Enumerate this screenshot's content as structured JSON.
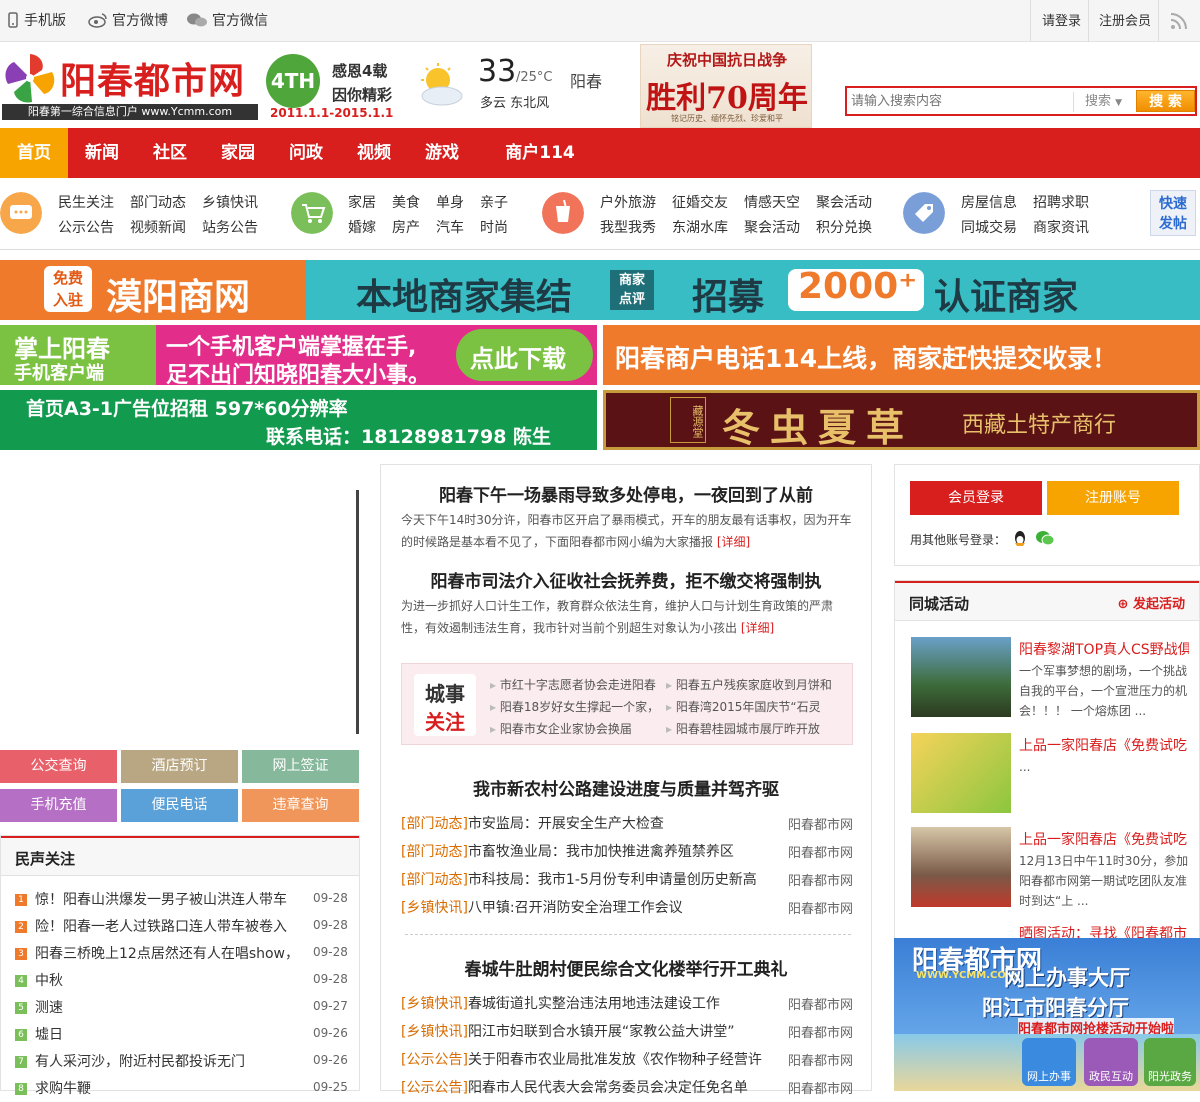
{
  "topbar": {
    "mobile": "手机版",
    "weibo": "官方微博",
    "wechat": "官方微信",
    "login": "请登录",
    "register": "注册会员"
  },
  "logo": {
    "title": "阳春都市网",
    "subtitle": "阳春第一综合信息门户 www.Ycmm.com"
  },
  "anniversary": {
    "badge": "4TH",
    "line1": "感恩4载",
    "line2": "因你精彩",
    "dates": "2011.1.1-2015.1.1"
  },
  "weather": {
    "temp": "33",
    "range": "/25°C",
    "city": "阳春",
    "condition": "多云  东北风"
  },
  "victory_banner": {
    "line1": "庆祝中国抗日战争",
    "line2": "胜利70周年",
    "line3": "铭记历史、缅怀先烈、珍爱和平"
  },
  "search": {
    "placeholder": "请输入搜索内容",
    "dropdown": "搜索",
    "button": "搜 索"
  },
  "nav": [
    "首页",
    "新闻",
    "社区",
    "家园",
    "问政",
    "视频",
    "游戏",
    "商户114"
  ],
  "subnav": {
    "group1": [
      "民生关注",
      "部门动态",
      "乡镇快讯",
      "公示公告",
      "视频新闻",
      "站务公告"
    ],
    "group2": [
      "家居",
      "美食",
      "单身",
      "亲子",
      "婚嫁",
      "房产",
      "汽车",
      "时尚"
    ],
    "group3": [
      "户外旅游",
      "征婚交友",
      "情感天空",
      "聚会活动",
      "我型我秀",
      "东湖水库",
      "聚会活动",
      "积分兑换"
    ],
    "group4": [
      "房屋信息",
      "招聘求职",
      "同城交易",
      "商家资讯"
    ],
    "quickpost": [
      "快速",
      "发帖"
    ]
  },
  "ads": {
    "banner1": {
      "badge": [
        "免费",
        "入驻"
      ],
      "name": "漠阳商网",
      "slogan": "本地商家集结",
      "mini": [
        "商家",
        "点评"
      ],
      "recruit": "招募",
      "count": "2000⁺",
      "tail": "认证商家"
    },
    "banner2": {
      "brand": [
        "掌上阳春",
        "手机客户端"
      ],
      "line1": "一个手机客户端掌握在手,",
      "line2": "足不出门知晓阳春大小事。",
      "download": "点此下载"
    },
    "banner3": "阳春商户电话114上线，商家赶快提交收录！",
    "banner4": {
      "line1": "首页A3-1广告位招租 597*60分辨率",
      "line2": "联系电话：18128981798 陈生"
    },
    "banner5": {
      "main": "冬虫夏草",
      "sub": "西藏土特产商行",
      "seal": "藏源堂"
    }
  },
  "quick_buttons": [
    {
      "label": "公交查询",
      "color": "#e8606a"
    },
    {
      "label": "酒店预订",
      "color": "#b9a784"
    },
    {
      "label": "网上签证",
      "color": "#86b89c"
    },
    {
      "label": "手机充值",
      "color": "#b56fc4"
    },
    {
      "label": "便民电话",
      "color": "#5aa0d9"
    },
    {
      "label": "违章查询",
      "color": "#f0965a"
    }
  ],
  "voices": {
    "title": "民声关注",
    "items": [
      {
        "n": "1",
        "title": "惊！阳春山洪爆发一男子被山洪连人带车",
        "date": "09-28"
      },
      {
        "n": "2",
        "title": "险！阳春一老人过铁路口连人带车被卷入",
        "date": "09-28"
      },
      {
        "n": "3",
        "title": "阳春三桥晚上12点居然还有人在唱show，",
        "date": "09-28"
      },
      {
        "n": "4",
        "title": "中秋",
        "date": "09-28"
      },
      {
        "n": "5",
        "title": "测速",
        "date": "09-27"
      },
      {
        "n": "6",
        "title": "墟日",
        "date": "09-26"
      },
      {
        "n": "7",
        "title": "有人采河沙，附近村民都投诉无门",
        "date": "09-26"
      },
      {
        "n": "8",
        "title": "求购牛鞭",
        "date": "09-25"
      }
    ]
  },
  "center": {
    "headline1": "阳春下午一场暴雨导致多处停电，一夜回到了从前",
    "summary1": "今天下午14时30分许，阳春市区开启了暴雨模式，开车的朋友最有话事权，因为开车的时候路是基本看不见了，下面阳春都市网小编为大家播报",
    "headline2": "阳春市司法介入征收社会抚养费，拒不缴交将强制执",
    "summary2": "为进一步抓好人口计生工作，教育群众依法生育，维护人口与计划生育政策的严肃性，有效遏制违法生育，我市针对当前个别超生对象认为小孩出",
    "detail": "[详细]",
    "cityfocus": {
      "a": "城事",
      "b": "关注",
      "items": [
        "市红十字志愿者协会走进阳春",
        "阳春五户残疾家庭收到月饼和",
        "阳春18岁好女生撑起一个家，",
        "阳春湾2015年国庆节“石灵",
        "阳春市女企业家协会换届",
        "阳春碧桂园城市展厅昨开放"
      ]
    },
    "headline3": "我市新农村公路建设进度与质量并驾齐驱",
    "list1": [
      {
        "tag": "[部门动态]",
        "title": "市安监局：开展安全生产大检查",
        "src": "阳春都市网"
      },
      {
        "tag": "[部门动态]",
        "title": "市畜牧渔业局：我市加快推进禽养殖禁养区",
        "src": "阳春都市网"
      },
      {
        "tag": "[部门动态]",
        "title": "市科技局：我市1-5月份专利申请量创历史新高",
        "src": "阳春都市网"
      },
      {
        "tag": "[乡镇快讯]",
        "title": "八甲镇:召开消防安全治理工作会议",
        "src": "阳春都市网"
      }
    ],
    "headline4": "春城牛肚朗村便民综合文化楼举行开工典礼",
    "list2": [
      {
        "tag": "[乡镇快讯]",
        "title": "春城街道扎实整治违法用地违法建设工作",
        "src": "阳春都市网"
      },
      {
        "tag": "[乡镇快讯]",
        "title": "阳江市妇联到合水镇开展“家教公益大讲堂”",
        "src": "阳春都市网"
      },
      {
        "tag": "[公示公告]",
        "title": "关于阳春市农业局批准发放《农作物种子经营许",
        "src": "阳春都市网"
      },
      {
        "tag": "[公示公告]",
        "title": "阳春市人民代表大会常务委员会决定任免名单",
        "src": "阳春都市网"
      }
    ]
  },
  "member": {
    "login": "会员登录",
    "register": "注册账号",
    "other": "用其他账号登录："
  },
  "activities": {
    "title": "同城活动",
    "launch": "发起活动",
    "items": [
      {
        "title": "阳春黎湖TOP真人CS野战俱",
        "desc": "一个军事梦想的剧场，一个挑战自我的平台，一个宣泄压力的机会！！！  一个熔炼团 ..."
      },
      {
        "title": "上品一家阳春店《免费试吃",
        "desc": "..."
      },
      {
        "title": "上品一家阳春店《免费试吃",
        "desc": "12月13日中午11时30分，参加阳春都市网第一期试吃团队友准时到达“上 ..."
      },
      {
        "title": "晒图活动：寻找《阳春都市",
        "desc": ""
      }
    ]
  },
  "float_ad": {
    "title": "阳春都市网",
    "url": "WWW.YCMM.COM",
    "l1": "网上办事大厅",
    "l2": "阳江市阳春分厅",
    "l3": "阳春都市网抢楼活动开始啦",
    "b1": "网上办事",
    "b2": "政民互动",
    "b3": "阳光政务"
  },
  "colors": {
    "brand_red": "#d91e1e",
    "accent_orange": "#f7a400"
  }
}
